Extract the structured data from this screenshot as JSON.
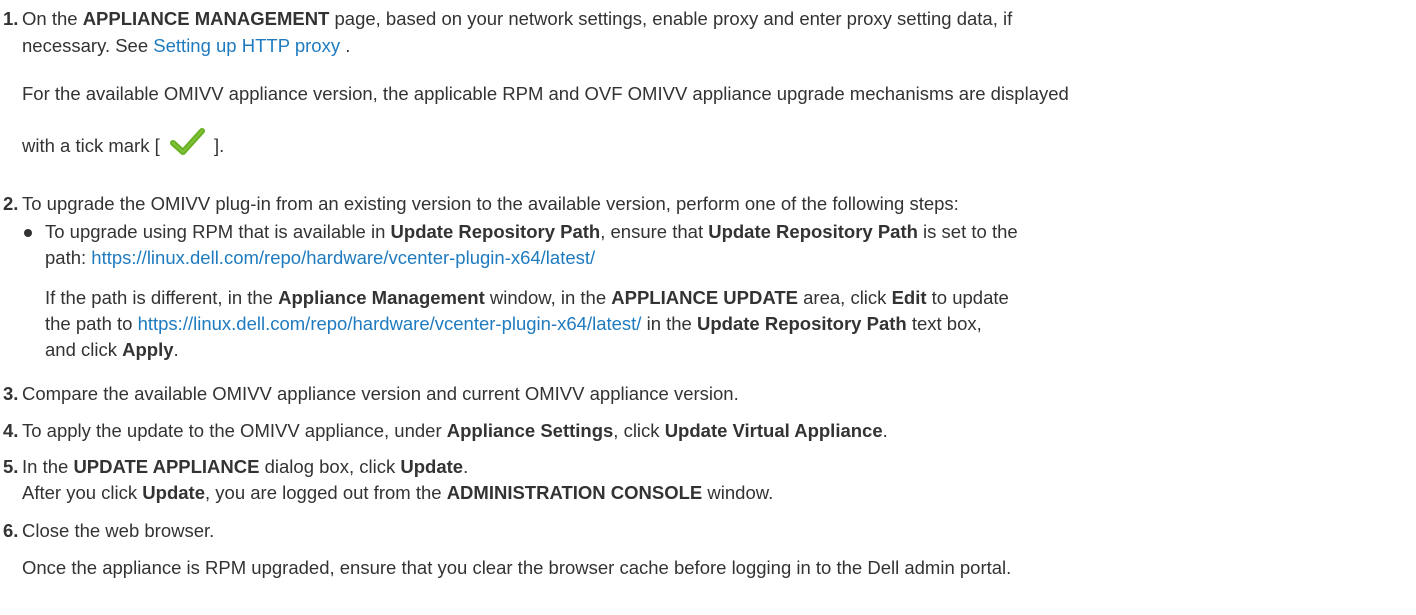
{
  "steps": [
    {
      "number": "1.",
      "line1": {
        "a": "On the ",
        "b": "APPLIANCE MANAGEMENT",
        "c": " page, based on your network settings, enable proxy and enter proxy setting data, if"
      },
      "line2": {
        "a": "necessary. See ",
        "link": "Setting up HTTP proxy",
        "c": " ."
      },
      "para1": "For the available OMIVV appliance version, the applicable RPM and OVF OMIVV appliance upgrade mechanisms are displayed",
      "para2a": "with a tick mark [",
      "para2b": "]."
    },
    {
      "number": "2.",
      "text": "To upgrade the OMIVV plug-in from an existing version to the available version, perform one of the following steps:",
      "bullet": {
        "a": "To upgrade using RPM that is available in ",
        "b": "Update Repository Path",
        "c": ", ensure that ",
        "d": "Update Repository Path",
        "e": " is set to the",
        "f": "path: ",
        "url": "https://linux.dell.com/repo/hardware/vcenter-plugin-x64/latest/"
      },
      "note": {
        "a": "If the path is different, in the ",
        "b": "Appliance Management",
        "c": " window, in the ",
        "d": "APPLIANCE UPDATE",
        "e": " area, click ",
        "f": "Edit",
        "g": " to update",
        "h": "the path to ",
        "url": "https://linux.dell.com/repo/hardware/vcenter-plugin-x64/latest/",
        "i": " in the ",
        "j": "Update Repository Path",
        "k": " text box,",
        "l": "and click ",
        "m": "Apply",
        "n": "."
      }
    },
    {
      "number": "3.",
      "text": "Compare the available OMIVV appliance version and current OMIVV appliance version."
    },
    {
      "number": "4.",
      "a": "To apply the update to the OMIVV appliance, under ",
      "b": "Appliance Settings",
      "c": ", click ",
      "d": "Update Virtual Appliance",
      "e": "."
    },
    {
      "number": "5.",
      "a": "In the ",
      "b": "UPDATE APPLIANCE",
      "c": " dialog box, click ",
      "d": "Update",
      "e": ".",
      "l2a": "After you click ",
      "l2b": "Update",
      "l2c": ", you are logged out from the ",
      "l2d": "ADMINISTRATION CONSOLE",
      "l2e": " window."
    },
    {
      "number": "6.",
      "text": "Close the web browser.",
      "note": "Once the appliance is RPM upgraded, ensure that you clear the browser cache before logging in to the Dell admin portal."
    }
  ],
  "colors": {
    "text": "#333333",
    "link": "#1f7bbf",
    "tick": "#6ab023"
  },
  "icons": {
    "tick": "check-mark-icon"
  }
}
